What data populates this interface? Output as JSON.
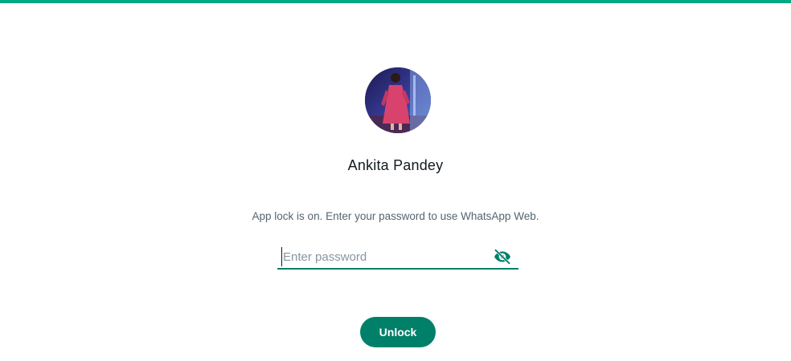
{
  "profile": {
    "name": "Ankita Pandey"
  },
  "lock": {
    "message": "App lock is on. Enter your password to use WhatsApp Web.",
    "password_placeholder": "Enter password",
    "password_value": "",
    "unlock_label": "Unlock"
  },
  "icons": {
    "visibility_toggle": "eye-off-icon"
  },
  "colors": {
    "accent": "#008069",
    "top_bar": "#00a884",
    "text_primary": "#111b21",
    "text_secondary": "#54656f",
    "placeholder": "#8696a0"
  }
}
